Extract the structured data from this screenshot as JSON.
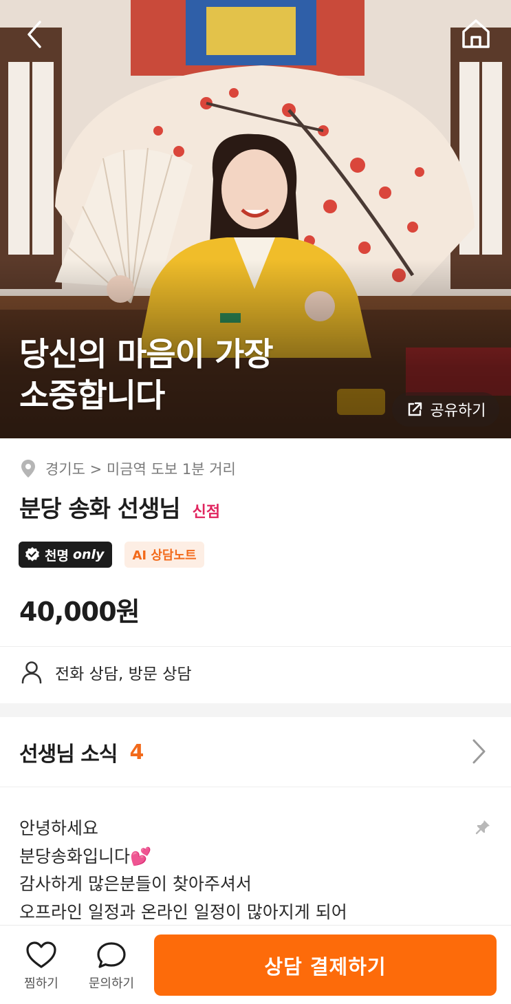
{
  "hero": {
    "title": "당신의 마음이 가장\n소중합니다",
    "share_label": "공유하기"
  },
  "profile": {
    "location": "경기도 > 미금역 도보 1분 거리",
    "name": "분당 송화 선생님",
    "new_label": "신점",
    "badges": {
      "premium_prefix": "천명",
      "premium_suffix": "only",
      "ai_note": "AI 상담노트"
    },
    "price": "40,000원",
    "consult_types": "전화 상담, 방문 상담"
  },
  "news": {
    "title": "선생님 소식",
    "count": "4",
    "lines": [
      "안녕하세요",
      "분당송화입니다💕",
      "감사하게 많은분들이 찾아주셔서",
      "오프라인 일정과 온라인 일정이 많아지게 되어"
    ]
  },
  "bottom_bar": {
    "like_label": "찜하기",
    "inquiry_label": "문의하기",
    "pay_label": "상담 결제하기"
  },
  "colors": {
    "accent": "#fd6b0a",
    "news_count": "#f26a1b",
    "new_badge": "#e0245e",
    "premium_badge_bg": "#1c1c1c",
    "ai_badge_bg": "#fdeee4"
  },
  "icons": [
    "back-arrow-icon",
    "home-icon",
    "share-external-icon",
    "location-pin-icon",
    "verified-check-icon",
    "person-icon",
    "chevron-right-icon",
    "pin-icon",
    "heart-icon",
    "chat-bubble-icon"
  ]
}
